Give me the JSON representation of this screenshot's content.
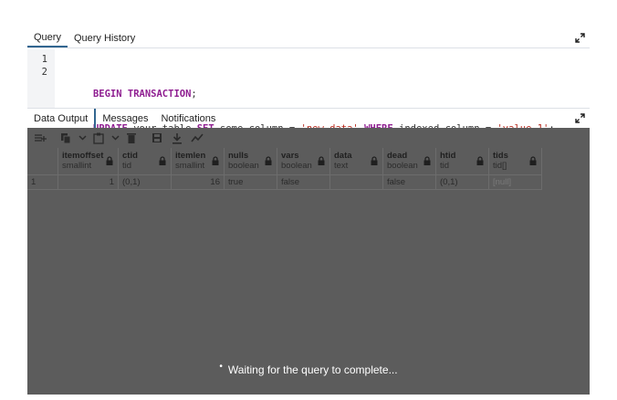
{
  "query_tabs": [
    {
      "label": "Query",
      "active": true
    },
    {
      "label": "Query History",
      "active": false
    }
  ],
  "editor": {
    "line_numbers": [
      "1",
      "2"
    ],
    "line1": [
      {
        "text": "BEGIN TRANSACTION",
        "cls": "kw"
      },
      {
        "text": ";",
        "cls": "id"
      }
    ],
    "line2": [
      {
        "text": "UPDATE",
        "cls": "kw"
      },
      {
        "text": " your_table ",
        "cls": "id"
      },
      {
        "text": "SET",
        "cls": "kw"
      },
      {
        "text": " some_column = ",
        "cls": "id"
      },
      {
        "text": "'new_data'",
        "cls": "str"
      },
      {
        "text": " ",
        "cls": "id"
      },
      {
        "text": "WHERE",
        "cls": "kw"
      },
      {
        "text": " indexed_column = ",
        "cls": "id"
      },
      {
        "text": "'value_1'",
        "cls": "str"
      },
      {
        "text": ";",
        "cls": "id"
      }
    ]
  },
  "output_tabs": [
    {
      "label": "Data Output",
      "active": true
    },
    {
      "label": "Messages",
      "active": false
    },
    {
      "label": "Notifications",
      "active": false
    }
  ],
  "toolbar_icons": [
    "add-row-icon",
    "copy-icon",
    "chevron-down-icon",
    "paste-icon",
    "chevron-down-icon",
    "delete-icon",
    "save-data-icon",
    "download-icon",
    "graph-icon"
  ],
  "columns": [
    {
      "name": "itemoffset",
      "type": "smallint"
    },
    {
      "name": "ctid",
      "type": "tid"
    },
    {
      "name": "itemlen",
      "type": "smallint"
    },
    {
      "name": "nulls",
      "type": "boolean"
    },
    {
      "name": "vars",
      "type": "boolean"
    },
    {
      "name": "data",
      "type": "text"
    },
    {
      "name": "dead",
      "type": "boolean"
    },
    {
      "name": "htid",
      "type": "tid"
    },
    {
      "name": "tids",
      "type": "tid[]"
    }
  ],
  "rows": [
    {
      "row_number": "1",
      "cells": [
        "1",
        "(0,1)",
        "16",
        "true",
        "false",
        "",
        "false",
        "(0,1)",
        "[null]"
      ]
    }
  ],
  "status": {
    "text": "Waiting for the query to complete..."
  },
  "colors": {
    "accent": "#326690",
    "keyword": "#8f1e91",
    "string": "#b52a1d",
    "overlay": "#5c5c5c"
  }
}
